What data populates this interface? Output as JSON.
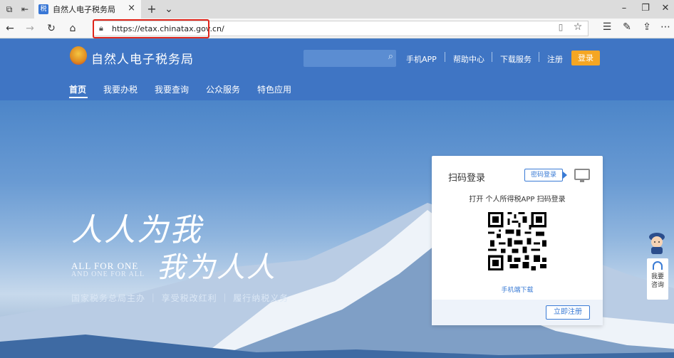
{
  "browser": {
    "tab_title": "自然人电子税务局",
    "tab_close": "×",
    "new_tab": "+",
    "tab_list": "⌄",
    "url": "https://etax.chinatax.gov.cn/",
    "win_minimize": "–",
    "win_restore": "❐",
    "win_close": "✕"
  },
  "header": {
    "site_title": "自然人电子税务局",
    "search_placeholder": "",
    "links": [
      "手机APP",
      "帮助中心",
      "下载服务",
      "注册"
    ],
    "login_button": "登录"
  },
  "menu": {
    "items": [
      "首页",
      "我要办税",
      "我要查询",
      "公众服务",
      "特色应用"
    ]
  },
  "hero": {
    "slogan_cn_line1": "人人为我",
    "slogan_cn_line2": "我为人人",
    "slogan_en_line1": "ALL FOR ONE",
    "slogan_en_line2": "AND ONE FOR ALL",
    "tagline": "国家税务总局主办 ｜ 享受税改红利 ｜ 履行纳税义务"
  },
  "login_card": {
    "title": "扫码登录",
    "password_login": "密码登录",
    "hint": "打开 个人所得税APP 扫码登录",
    "mobile_download": "手机端下载",
    "register_button": "立即注册"
  },
  "side_widget": {
    "consult_line1": "我要",
    "consult_line2": "咨询"
  },
  "colors": {
    "header_bg": "#3f75c4",
    "login_orange": "#f5a623",
    "link_blue": "#3a7bd5",
    "url_highlight": "#e0251b"
  }
}
